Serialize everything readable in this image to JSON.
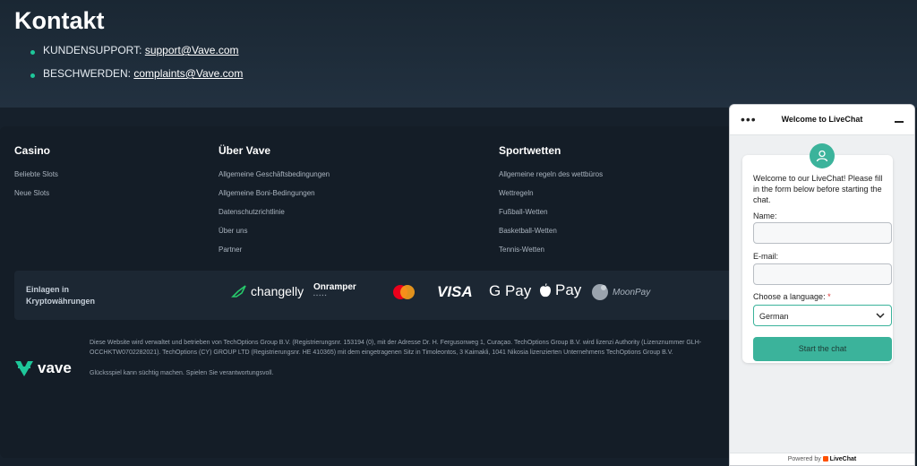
{
  "contact": {
    "title": "Kontakt",
    "items": [
      {
        "label": "KUNDENSUPPORT: ",
        "link": "support@Vave.com"
      },
      {
        "label": "BESCHWERDEN: ",
        "link": "complaints@Vave.com"
      }
    ]
  },
  "footer": {
    "columns": [
      {
        "title": "Casino",
        "links": [
          "Beliebte Slots",
          "Neue Slots"
        ]
      },
      {
        "title": "Über Vave",
        "links": [
          "Allgemeine Geschäftsbedingungen",
          "Allgemeine Boni-Bedingungen",
          "Datenschutzrichtlinie",
          "Über uns",
          "Partner"
        ]
      },
      {
        "title": "Sportwetten",
        "links": [
          "Allgemeine regeln des wettbüros",
          "Wettregeln",
          "Fußball-Wetten",
          "Basketball-Wetten",
          "Tennis-Wetten"
        ]
      }
    ],
    "crypto": {
      "label": "Einlagen in Kryptowährungen",
      "providers": [
        "changelly",
        "Onramper",
        "VISA",
        "G Pay",
        "Pay",
        "MoonPay"
      ]
    },
    "brand": "vave",
    "legal": [
      "Diese Website wird verwaltet und betrieben von TechOptions Group B.V. (Registrierungsnr. 153194 (0), mit der Adresse Dr. H. Fergusonweg 1, Curaçao. TechOptions Group B.V. wird lizenzi Authority (Lizenznummer GLH-OCCHKTW0702282021). TechOptions (CY) GROUP LTD (Registrierungsnr. HE 410365) mit dem eingetragenen Sitz in Timoleontos, 3 Kaimakli, 1041 Nikosia lizenzierten Unternehmens TechOptions Group B.V.",
      "Glücksspiel kann süchtig machen. Spielen Sie verantwortungsvoll."
    ]
  },
  "chat": {
    "title": "Welcome to LiveChat",
    "intro": "Welcome to our LiveChat! Please fill in the form below before starting the chat.",
    "name_label": "Name:",
    "email_label": "E-mail:",
    "language_label": "Choose a language:",
    "required_mark": "*",
    "language_value": "German",
    "start_button": "Start the chat",
    "powered_prefix": "Powered by",
    "powered_brand": "LiveChat",
    "accent": "#3bb39b"
  }
}
